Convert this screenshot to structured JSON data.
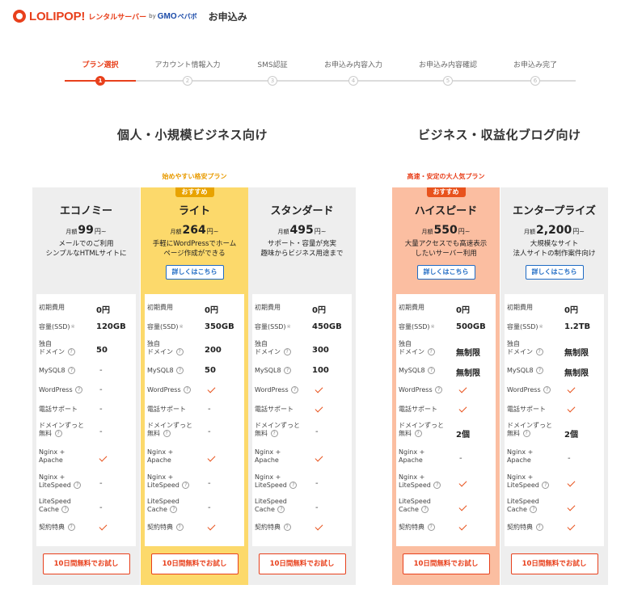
{
  "header": {
    "brand": "LOLIPOP!",
    "brand_sub": "レンタルサーバー",
    "by": "by",
    "gmo": "GMO",
    "gmo_sub": "ペパボ",
    "title": "お申込み"
  },
  "stepper": {
    "steps": [
      {
        "label": "プラン選択",
        "num": "1"
      },
      {
        "label": "アカウント情報入力",
        "num": "2"
      },
      {
        "label": "SMS認証",
        "num": "3"
      },
      {
        "label": "お申込み内容入力",
        "num": "4"
      },
      {
        "label": "お申込み内容確認",
        "num": "5"
      },
      {
        "label": "お申込み完了",
        "num": "6"
      }
    ],
    "active_index": 0
  },
  "sections": {
    "left_title": "個人・小規模ビジネス向け",
    "right_title": "ビジネス・収益化ブログ向け"
  },
  "spec_labels": {
    "initial_fee": "初期費用",
    "capacity": "容量(SSD)",
    "domain_1": "独自",
    "domain_2": "ドメイン",
    "mysql": "MySQL8",
    "wordpress": "WordPress",
    "phone": "電話サポート",
    "domain_free_1": "ドメインずっと",
    "domain_free_2": "無料",
    "nginx_1": "Nginx +",
    "nginx_2": "Apache",
    "litespeed_1": "Nginx +",
    "litespeed_2": "LiteSpeed",
    "cache_1": "LiteSpeed",
    "cache_2": "Cache",
    "contract": "契約特典",
    "asterisk": "※",
    "q": "?"
  },
  "plans": [
    {
      "recommend_note": "",
      "badge": "",
      "name": "エコノミー",
      "price_prefix": "月額",
      "price": "99",
      "price_suffix": "円~",
      "desc_1": "メールでのご利用",
      "desc_2": "シンプルなHTMLサイトに",
      "detail_button": "",
      "initial_fee": "0円",
      "capacity": "120GB",
      "domains": "50",
      "mysql": "-",
      "wordpress": "-",
      "phone": "-",
      "domain_free": "-",
      "nginx_apache": "check",
      "nginx_litespeed": "-",
      "litespeed_cache": "-",
      "contract": "check",
      "trial_button": "10日間無料でお試し"
    },
    {
      "recommend_note": "始めやすい格安プラン",
      "badge": "おすすめ",
      "name": "ライト",
      "price_prefix": "月額",
      "price": "264",
      "price_suffix": "円~",
      "desc_1": "手軽にWordPressでホーム",
      "desc_2": "ページ作成ができる",
      "detail_button": "詳しくはこちら",
      "initial_fee": "0円",
      "capacity": "350GB",
      "domains": "200",
      "mysql": "50",
      "wordpress": "check",
      "phone": "-",
      "domain_free": "-",
      "nginx_apache": "check",
      "nginx_litespeed": "-",
      "litespeed_cache": "-",
      "contract": "check",
      "trial_button": "10日間無料でお試し"
    },
    {
      "recommend_note": "",
      "badge": "",
      "name": "スタンダード",
      "price_prefix": "月額",
      "price": "495",
      "price_suffix": "円~",
      "desc_1": "サポート・容量が充実",
      "desc_2": "趣味からビジネス用途まで",
      "detail_button": "",
      "initial_fee": "0円",
      "capacity": "450GB",
      "domains": "300",
      "mysql": "100",
      "wordpress": "check",
      "phone": "check",
      "domain_free": "-",
      "nginx_apache": "check",
      "nginx_litespeed": "-",
      "litespeed_cache": "-",
      "contract": "check",
      "trial_button": "10日間無料でお試し"
    },
    {
      "recommend_note": "高速・安定の大人気プラン",
      "badge": "おすすめ",
      "name": "ハイスピード",
      "price_prefix": "月額",
      "price": "550",
      "price_suffix": "円~",
      "desc_1": "大量アクセスでも高速表示",
      "desc_2": "したいサーバー利用",
      "detail_button": "詳しくはこちら",
      "initial_fee": "0円",
      "capacity": "500GB",
      "domains": "無制限",
      "mysql": "無制限",
      "wordpress": "check",
      "phone": "check",
      "domain_free": "2個",
      "nginx_apache": "-",
      "nginx_litespeed": "check",
      "litespeed_cache": "check",
      "contract": "check",
      "trial_button": "10日間無料でお試し"
    },
    {
      "recommend_note": "",
      "badge": "",
      "name": "エンタープライズ",
      "price_prefix": "月額",
      "price": "2,200",
      "price_suffix": "円~",
      "desc_1": "大規模なサイト",
      "desc_2": "法人サイトの制作案件向け",
      "detail_button": "詳しくはこちら",
      "initial_fee": "0円",
      "capacity": "1.2TB",
      "domains": "無制限",
      "mysql": "無制限",
      "wordpress": "check",
      "phone": "check",
      "domain_free": "2個",
      "nginx_apache": "-",
      "nginx_litespeed": "check",
      "litespeed_cache": "check",
      "contract": "check",
      "trial_button": "10日間無料でお試し"
    }
  ],
  "colors": {
    "accent": "#e8401c",
    "link_blue": "#1f6bc4",
    "light_card": "#eeeeee",
    "yellow_card": "#fcd96b",
    "orange_card": "#fbbea1"
  }
}
